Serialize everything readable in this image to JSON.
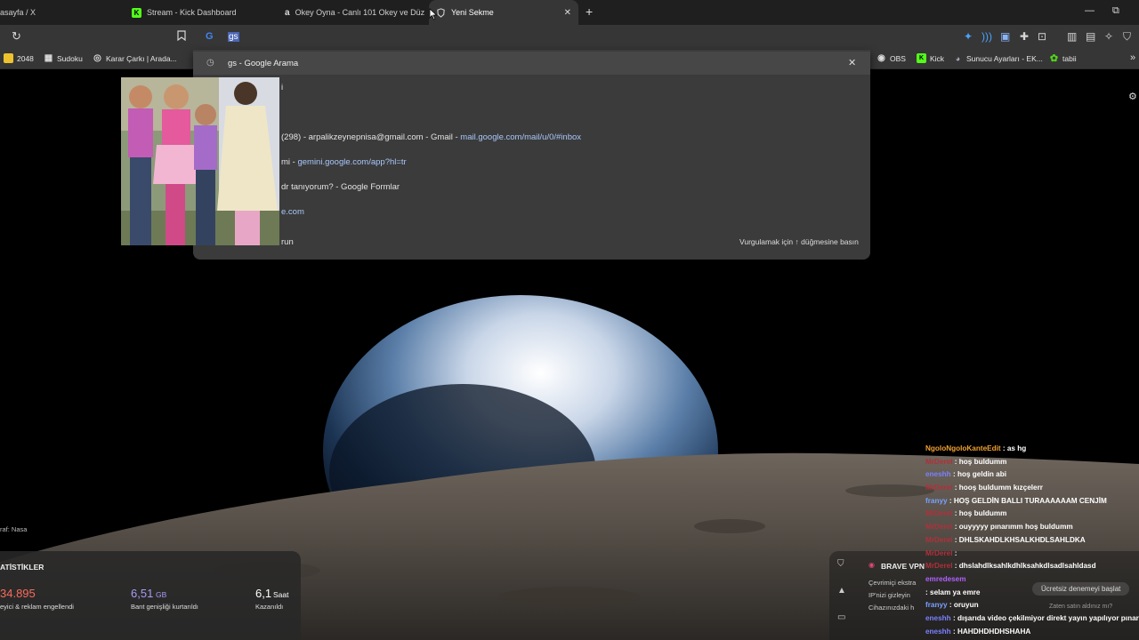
{
  "tabs": [
    {
      "label": "asayfa / X"
    },
    {
      "label": "Stream - Kick Dashboard"
    },
    {
      "label": "Okey Oyna - Canlı 101 Okey ve Düz"
    },
    {
      "label": "Yeni Sekme"
    }
  ],
  "omnibox": {
    "typed": "gs"
  },
  "bookmarks": [
    {
      "label": "2048"
    },
    {
      "label": "Sudoku"
    },
    {
      "label": "Karar Çarkı | Arada..."
    },
    {
      "label": "OBS"
    },
    {
      "label": "Kick"
    },
    {
      "label": "Sunucu Ayarları - EK..."
    },
    {
      "label": "tabii"
    }
  ],
  "suggestions": {
    "search": "gs - Google Arama",
    "gmail_text": "(298) - arpalikzeynepnisa@gmail.com - Gmail -",
    "gmail_url": "mail.google.com/mail/u/0/#inbox",
    "gemini_text": "mi -",
    "gemini_url": "gemini.google.com/app?hl=tr",
    "forms_text": "dr tanıyorum? - Google Formlar",
    "partial_url": "e.com",
    "partial_run": "run",
    "partial_top": "i",
    "hint": "Vurgulamak için ↑ düğmesine basın"
  },
  "photo_credit": "raf: Nasa",
  "stats": {
    "title": "ATİSTİKLER",
    "blocked_value": "34.895",
    "blocked_label": "eyici & reklam engellendi",
    "bandwidth_value": "6,51",
    "bandwidth_unit": "GB",
    "bandwidth_label": "Bant genişliği kurtarıldı",
    "time_value": "6,1",
    "time_unit": "Saat",
    "time_label": "Kazanıldı"
  },
  "vpn": {
    "title": "BRAVE VPN",
    "line1": "Çevrimiçi ekstra",
    "line2": "IP'nizi gizleyin",
    "line3": "Cihazınızdaki h",
    "cta": "Ücretsiz denemeyi başlat",
    "sub": "Zaten satın aldınız mı?"
  },
  "chat": [
    {
      "user": "NgoloNgoloKanteEdit",
      "sep": " : ",
      "msg": "as hg",
      "color": "#f0a030"
    },
    {
      "user": "MrDerel",
      "sep": " : ",
      "msg": "hoş buldumm",
      "color": "#b0303a"
    },
    {
      "user": "eneshh",
      "sep": " : ",
      "msg": "hoş geldin abi",
      "color": "#7a80ff"
    },
    {
      "user": "MrDerel",
      "sep": " : ",
      "msg": "hooş buldumm kızçelerr",
      "color": "#b0303a"
    },
    {
      "user": "franyy",
      "sep": " : ",
      "msg": "HOŞ GELDİN BALLI TURAAAAAAM CENJİM",
      "color": "#7aa0ff"
    },
    {
      "user": "MrDerel",
      "sep": " : ",
      "msg": "hoş buldumm",
      "color": "#b0303a"
    },
    {
      "user": "MrDerel",
      "sep": " : ",
      "msg": "ouyyyyy pınarımm hoş buldumm",
      "color": "#b0303a"
    },
    {
      "user": "MrDerel",
      "sep": " : ",
      "msg": "DHLSKAHDLKHSALKHDLSAHLDKA",
      "color": "#b0303a"
    },
    {
      "user": "MrDerel",
      "sep": " : ",
      "msg": "",
      "color": "#b0303a"
    },
    {
      "user": "MrDerel",
      "sep": " : ",
      "msg": "dhslahdlksahlkdhlksahkdlsadlsahldasd",
      "color": "#b0303a"
    },
    {
      "user": "emredesem",
      "sep": "",
      "msg": "",
      "color": "#b060ff"
    },
    {
      "user": "",
      "sep": " : ",
      "msg": "selam ya emre",
      "color": "#b0303a"
    },
    {
      "user": "franyy",
      "sep": " : ",
      "msg": "oruyun",
      "color": "#7aa0ff"
    },
    {
      "user": "eneshh",
      "sep": " : ",
      "msg": "dışarıda video çekilmiyor direkt yayın yapılıyor pınar ab",
      "color": "#7a80ff"
    },
    {
      "user": "eneshh",
      "sep": " : ",
      "msg": "HAHDHDHDHSHAHA",
      "color": "#7a80ff"
    }
  ]
}
